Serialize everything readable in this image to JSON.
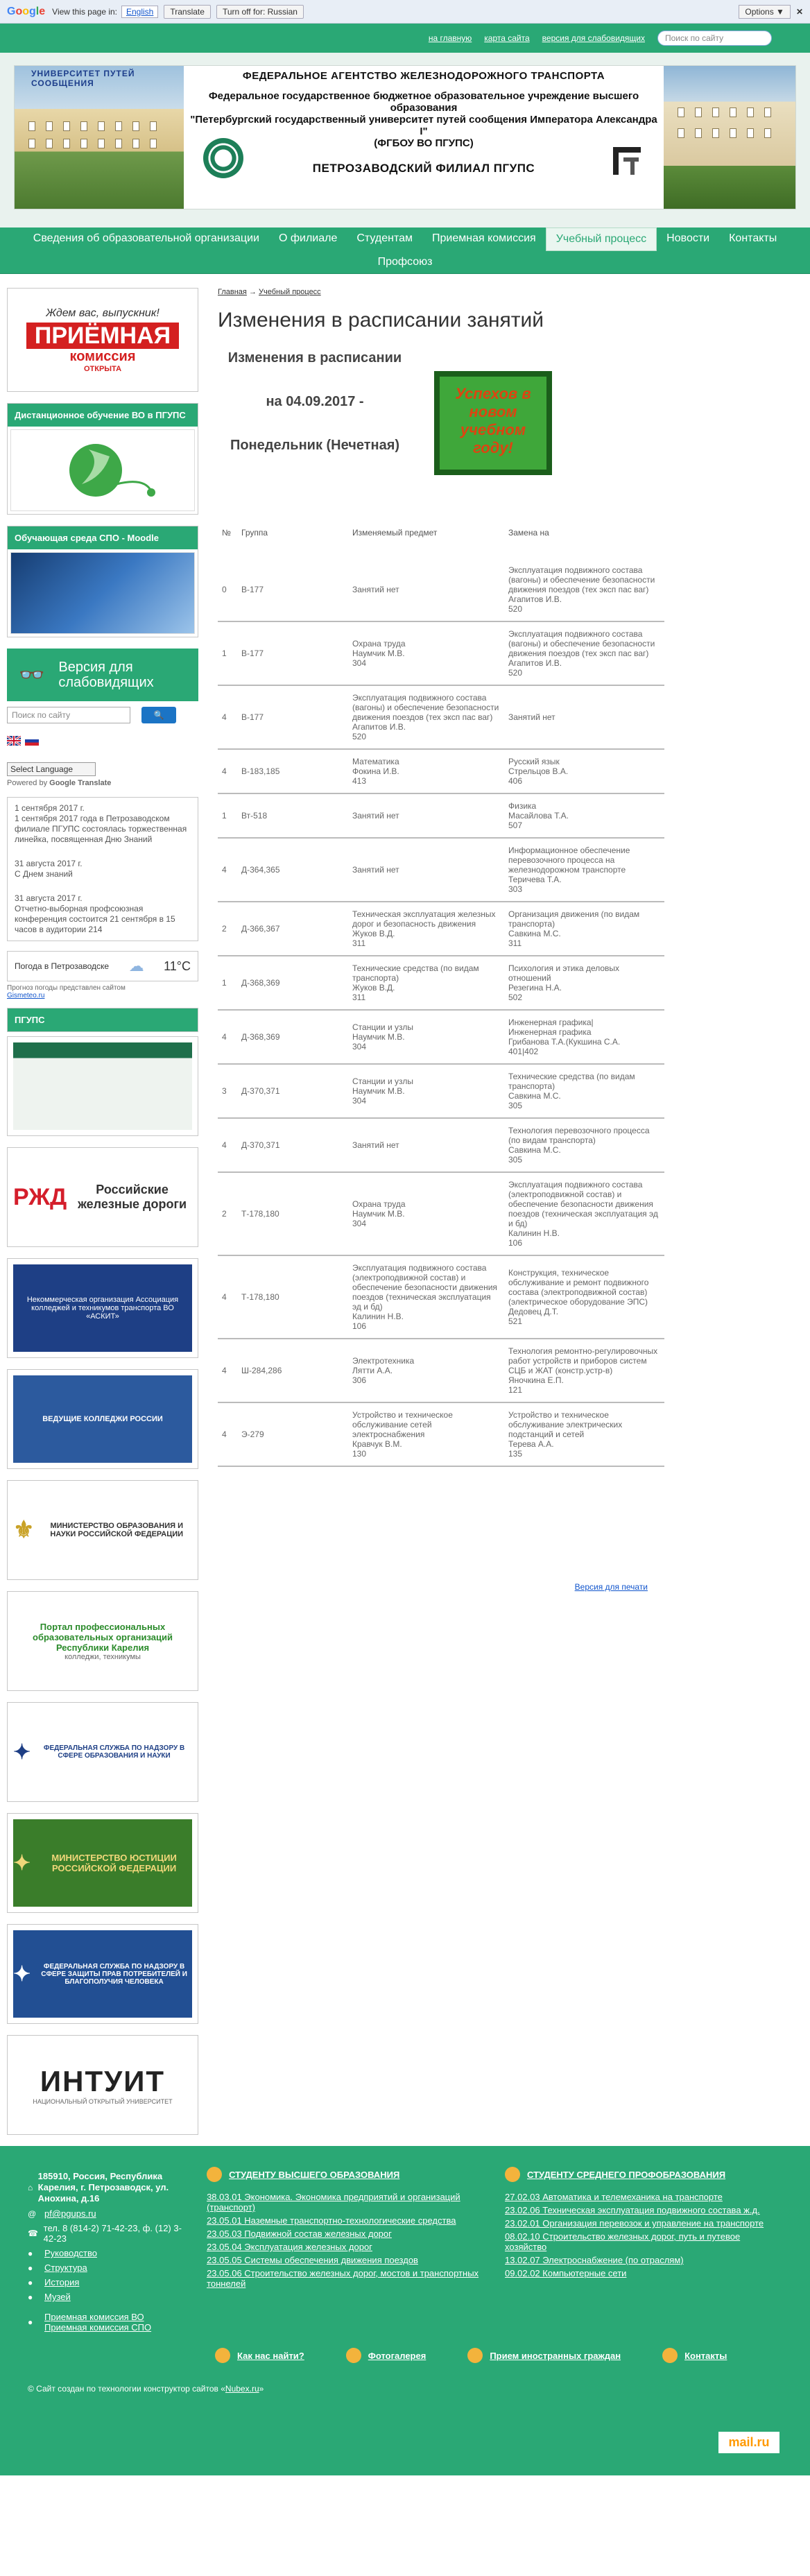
{
  "translate_bar": {
    "logo": "Google",
    "text": "View this page in:",
    "language": "English",
    "translate_btn": "Translate",
    "turnoff_btn": "Turn off for: Russian",
    "options_btn": "Options ▼",
    "close": "✕"
  },
  "topbar": {
    "link_home": "на главную",
    "link_sitemap": "карта сайта",
    "link_impaired": "версия для слабовидящих",
    "search_placeholder": "Поиск по сайту"
  },
  "header": {
    "line1": "ФЕДЕРАЛЬНОЕ АГЕНТСТВО ЖЕЛЕЗНОДОРОЖНОГО ТРАНСПОРТА",
    "line2": "Федеральное государственное бюджетное образовательное учреждение высшего образования\n\"Петербургский государственный университет путей сообщения Императора Александра I\"\n(ФГБОУ ВО ПГУПС)",
    "line3": "ПЕТРОЗАВОДСКИЙ ФИЛИАЛ ПГУПС",
    "photo_caption": "УНИВЕРСИТЕТ ПУТЕЙ СООБЩЕНИЯ"
  },
  "nav": {
    "items": [
      "Сведения об образовательной организации",
      "О филиале",
      "Студентам",
      "Приемная комиссия",
      "Учебный процесс",
      "Новости",
      "Контакты"
    ],
    "row2": "Профсоюз"
  },
  "sidebar": {
    "promo": {
      "t1": "Ждем вас, выпускник!",
      "t2": "ПРИЁМНАЯ",
      "t3": "комиссия",
      "badge": "ОТКРЫТА"
    },
    "distance_title": "Дистанционное обучение ВО в ПГУПС",
    "moodle_title": "Обучающая среда СПО - Moodle",
    "version_label": "Версия для слабовидящих",
    "search_placeholder": "Поиск по сайту",
    "select_language": "Select Language",
    "powered": "Powered by",
    "powered_google": "Google",
    "powered_translate": "Translate",
    "news": [
      {
        "date": "1 сентября 2017 г.",
        "text": "1 сентября 2017 года в Петрозаводском филиале ПГУПС состоялась торжественная линейка, посвященная Дню Знаний"
      },
      {
        "date": "31 августа 2017 г.",
        "text": "С Днем знаний"
      },
      {
        "date": "31 августа 2017 г.",
        "text": "Отчетно-выборная профсоюзная конференция состоится 21 сентября в 15 часов в аудитории 214"
      }
    ],
    "weather": {
      "label": "Погода в Петрозаводске",
      "temp": "11°C",
      "note": "Прогноз погоды представлен сайтом",
      "link": "Gismeteo.ru"
    },
    "pgups_title": "ПГУПС",
    "rzd": "Российские железные дороги",
    "assoc": "Некоммерческая организация Ассоциация колледжей и техникумов транспорта ВО «АСКИТ»",
    "logo3": "ВЕДУЩИЕ КОЛЛЕДЖИ РОССИИ",
    "minobr": "МИНИСТЕРСТВО ОБРАЗОВАНИЯ И НАУКИ РОССИЙСКОЙ ФЕДЕРАЦИИ",
    "portal": "Портал профессиональных образовательных организаций Республики Карелия",
    "portal_sub": "колледжи, техникумы",
    "rosobr": "ФЕДЕРАЛЬНАЯ СЛУЖБА ПО НАДЗОРУ В СФЕРЕ ОБРАЗОВАНИЯ И НАУКИ",
    "minjust": "МИНИСТЕРСТВО ЮСТИЦИИ РОССИЙСКОЙ ФЕДЕРАЦИИ",
    "rospotreb": "ФЕДЕРАЛЬНАЯ СЛУЖБА ПО НАДЗОРУ В СФЕРЕ ЗАЩИТЫ ПРАВ ПОТРЕБИТЕЛЕЙ И БЛАГОПОЛУЧИЯ ЧЕЛОВЕКА",
    "intuit": "ИНТУИТ",
    "intuit_sub": "НАЦИОНАЛЬНЫЙ ОТКРЫТЫЙ УНИВЕРСИТЕТ"
  },
  "content": {
    "crumb_home": "Главная",
    "crumb_sep": "→",
    "crumb_section": "Учебный процесс",
    "title": "Изменения в расписании занятий",
    "hero_l1": "Изменения в расписании",
    "hero_l2": "на 04.09.2017 -",
    "hero_l3": "Понедельник (Нечетная)",
    "hero_board": "Успехов в новом учебном году!",
    "columns": [
      "№",
      "Группа",
      "Изменяемый предмет",
      "Замена на"
    ],
    "rows": [
      [
        "0",
        "В-177",
        "Занятий нет",
        "Эксплуатация подвижного состава (вагоны) и обеспечение безопасности движения поездов (тех эксп пас ваг)\nАгапитов И.В.\n520"
      ],
      [
        "1",
        "В-177",
        "Охрана труда\nНаумчик М.В.\n304",
        "Эксплуатация подвижного состава (вагоны) и обеспечение безопасности движения поездов (тех эксп пас ваг)\nАгапитов И.В.\n520"
      ],
      [
        "4",
        "В-177",
        "Эксплуатация подвижного состава (вагоны) и обеспечение безопасности движения поездов (тех эксп пас ваг)\nАгапитов И.В.\n520",
        "Занятий нет"
      ],
      [
        "4",
        "В-183,185",
        "Математика\nФокина И.В.\n413",
        "Русский язык\nСтрельцов В.А.\n406"
      ],
      [
        "1",
        "Вт-518",
        "Занятий нет",
        "Физика\nМасайлова Т.А.\n507"
      ],
      [
        "4",
        "Д-364,365",
        "Занятий нет",
        "Информационное обеспечение перевозочного процесса на железнодорожном транспорте\nТеричева Т.А.\n303"
      ],
      [
        "2",
        "Д-366,367",
        "Техническая эксплуатация железных дорог и безопасность движения\nЖуков В.Д.\n311",
        "Организация движения (по видам транспорта)\nСавкина М.С.\n311"
      ],
      [
        "1",
        "Д-368,369",
        "Технические средства (по видам транспорта)\nЖуков В.Д.\n311",
        "Психология и этика деловых отношений\nРезегина Н.А.\n502"
      ],
      [
        "4",
        "Д-368,369",
        "Станции и узлы\nНаумчик М.В.\n304",
        "Инженерная графика|\nИнженерная графика\nГрибанова Т.А.(Кукшина С.А.\n401|402"
      ],
      [
        "3",
        "Д-370,371",
        "Станции и узлы\nНаумчик М.В.\n304",
        "Технические средства (по видам транспорта)\nСавкина М.С.\n305"
      ],
      [
        "4",
        "Д-370,371",
        "Занятий нет",
        "Технология перевозочного процесса (по видам транспорта)\nСавкина М.С.\n305"
      ],
      [
        "2",
        "Т-178,180",
        "Охрана труда\nНаумчик М.В.\n304",
        "Эксплуатация подвижного состава (электроподвижной состав) и обеспечение безопасности движения поездов (техническая эксплуатация эд и бд)\nКалинин Н.В.\n106"
      ],
      [
        "4",
        "Т-178,180",
        "Эксплуатация подвижного состава (электроподвижной состав) и обеспечение безопасности движения поездов (техническая эксплуатация эд и бд)\nКалинин Н.В.\n106",
        "Конструкция, техническое обслуживание и ремонт подвижного состава (электроподвижной состав) (электрическое оборудование ЭПС)\nДедовец Д.Т.\n521"
      ],
      [
        "4",
        "Ш-284,286",
        "Электротехника\nЛятти А.А.\n306",
        "Технология ремонтно-регулировочных работ устройств и приборов систем СЦБ и ЖАТ (констр.устр-в)\nЯночкина Е.П.\n121"
      ],
      [
        "4",
        "Э-279",
        "Устройство и техническое обслуживание сетей электроснабжения\nКравчук В.М.\n130",
        "Устройство и техническое обслуживание электрических подстанций и сетей\nТерева А.А.\n135"
      ]
    ],
    "print_link": "Версия для печати"
  },
  "footer": {
    "address": "185910, Россия, Республика Карелия, г. Петрозаводск, ул. Анохина, д.16",
    "email": "pf@pgups.ru",
    "phone": "тел. 8 (814-2) 71-42-23, ф. (12) 3-42-23",
    "links": [
      "Руководство",
      "Структура",
      "История",
      "Музей"
    ],
    "admission_vo": "Приемная комиссия ВО",
    "admission_spo": "Приемная комиссия СПО",
    "vo_title": "СТУДЕНТУ ВЫСШЕГО ОБРАЗОВАНИЯ",
    "vo_items": [
      "38.03.01 Экономика. Экономика предприятий и организаций (транспорт)",
      "23.05.01 Наземные транспортно-технологические средства",
      "23.05.03 Подвижной состав железных дорог",
      "23.05.04 Эксплуатация железных дорог",
      "23.05.05 Системы обеспечения движения поездов",
      "23.05.06 Строительство железных дорог, мостов и транспортных тоннелей"
    ],
    "spo_title": "СТУДЕНТУ СРЕДНЕГО ПРОФОБРАЗОВАНИЯ",
    "spo_items": [
      "27.02.03 Автоматика и телемеханика на транспорте",
      "23.02.06 Техническая эксплуатация подвижного состава ж.д.",
      "23.02.01 Организация перевозок и управление на транспорте",
      "08.02.10 Строительство железных дорог, путь и путевое хозяйство",
      "13.02.07 Электроснабжение (по отраслям)",
      "09.02.02 Компьютерные сети"
    ],
    "find_us": "Как нас найти?",
    "gallery": "Фотогалерея",
    "foreign": "Прием иностранных граждан",
    "contacts": "Контакты",
    "copyright_text": "© Сайт создан по технологии конструктор сайтов «",
    "copyright_link": "Nubex.ru",
    "copyright_end": "»",
    "counter": "mail.ru"
  }
}
